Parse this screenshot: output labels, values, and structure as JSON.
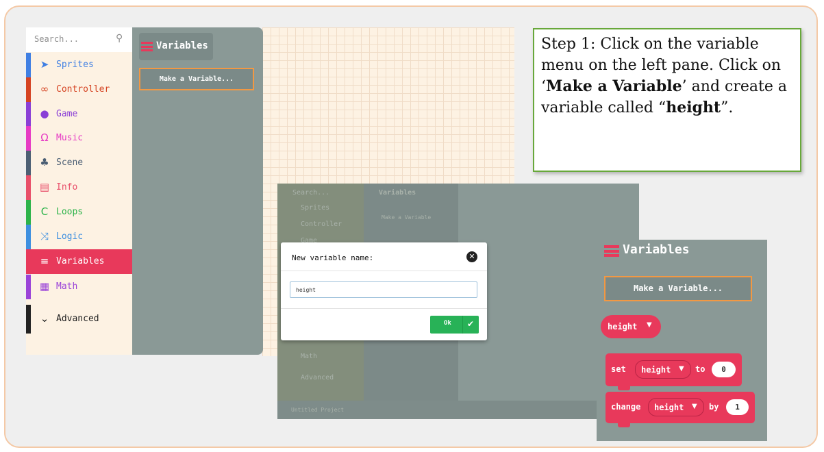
{
  "step_box": {
    "parts": [
      {
        "text": "Step 1: Click on the variable menu on the left pane. Click on ‘",
        "bold": false
      },
      {
        "text": "Make a Variable",
        "bold": true
      },
      {
        "text": "’ and create a variable called “",
        "bold": false
      },
      {
        "text": "height",
        "bold": true
      },
      {
        "text": "”.",
        "bold": false
      }
    ]
  },
  "panel1": {
    "search_placeholder": "Search...",
    "search_icon": "magnifier-icon",
    "categories": [
      {
        "label": "Sprites",
        "icon": "paper-plane-icon",
        "color": "#3f7fe3"
      },
      {
        "label": "Controller",
        "icon": "gamepad-icon",
        "color": "#d54322"
      },
      {
        "label": "Game",
        "icon": "circle-icon",
        "color": "#8a3fd6"
      },
      {
        "label": "Music",
        "icon": "headphones-icon",
        "color": "#e63bc4"
      },
      {
        "label": "Scene",
        "icon": "tree-icon",
        "color": "#4c5f74"
      },
      {
        "label": "Info",
        "icon": "id-card-icon",
        "color": "#e84f6a"
      },
      {
        "label": "Loops",
        "icon": "refresh-icon",
        "color": "#2cb34a"
      },
      {
        "label": "Logic",
        "icon": "shuffle-icon",
        "color": "#3d8fe0"
      },
      {
        "label": "Variables",
        "icon": "list-icon",
        "color": "#e8395b"
      },
      {
        "label": "Math",
        "icon": "calculator-icon",
        "color": "#9a43d8"
      },
      {
        "label": "Advanced",
        "icon": "chevron-down-icon",
        "color": "#222222"
      }
    ],
    "flyout_title": "Variables",
    "make_variable_label": "Make a Variable..."
  },
  "panel2": {
    "ghost_search": "Search...",
    "ghost_categories": [
      "Sprites",
      "Controller",
      "Game",
      "Math",
      "Advanced"
    ],
    "ghost_flyout_title": "Variables",
    "ghost_make_variable": "Make a Variable",
    "ghost_footer": "Untitled Project",
    "dialog": {
      "title": "New variable name:",
      "input_value": "height",
      "ok_label": "Ok"
    }
  },
  "panel3": {
    "title": "Variables",
    "make_variable_label": "Make a Variable...",
    "variable_name": "height",
    "set_block": {
      "keyword": "set",
      "variable": "height",
      "to": "to",
      "value": "0"
    },
    "change_block": {
      "keyword": "change",
      "variable": "height",
      "by": "by",
      "value": "1"
    }
  },
  "colors": {
    "variables_pink": "#e8395b",
    "flyout_gray": "#8a9996",
    "highlight_orange": "#f29843",
    "ok_green": "#28b257",
    "step_border_green": "#68a83a"
  }
}
